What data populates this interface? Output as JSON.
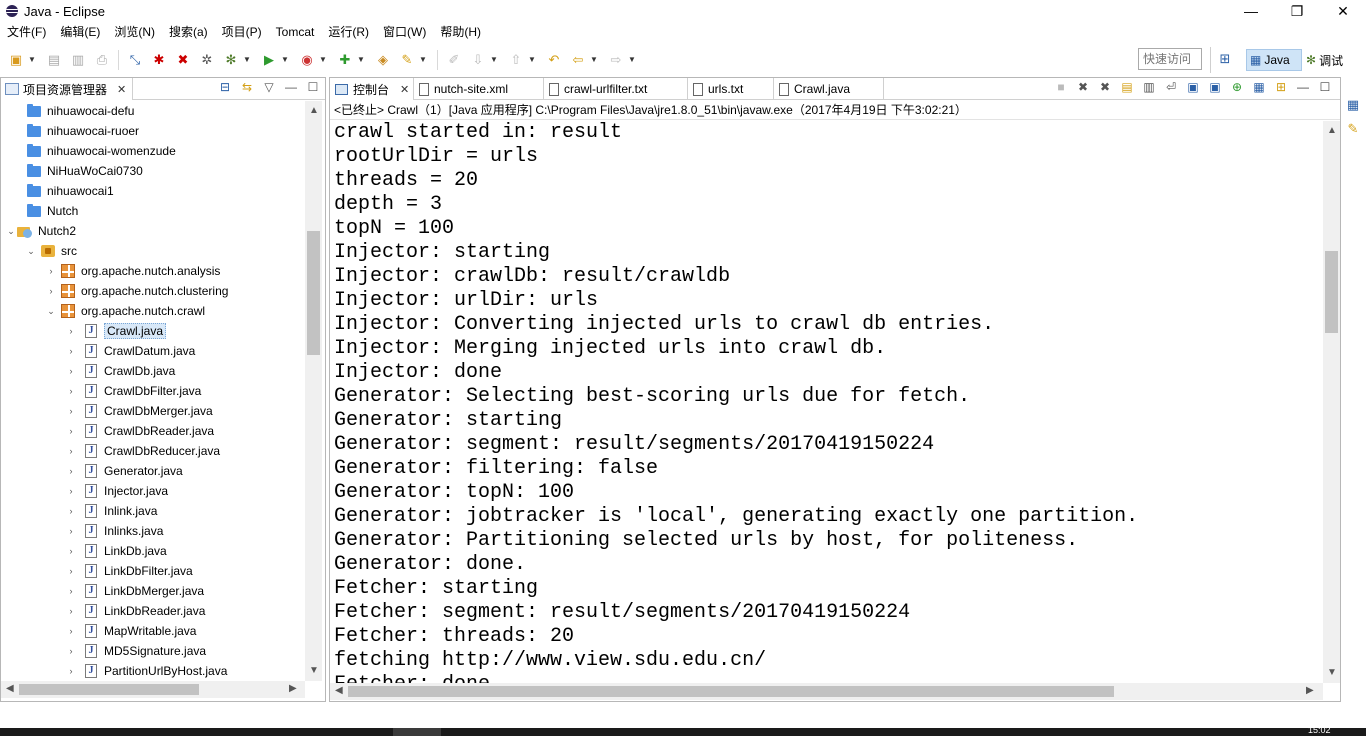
{
  "window": {
    "title": "Java - Eclipse",
    "controls": {
      "minimize": "—",
      "restore": "❐",
      "close": "✕"
    }
  },
  "menu": [
    "文件(F)",
    "编辑(E)",
    "浏览(N)",
    "搜索(a)",
    "项目(P)",
    "Tomcat",
    "运行(R)",
    "窗口(W)",
    "帮助(H)"
  ],
  "toolbar": {
    "quick_access_placeholder": "快速访问",
    "perspectives": {
      "java": "Java",
      "debug": "调试"
    }
  },
  "explorer": {
    "title": "项目资源管理器",
    "items": [
      {
        "label": "nihuawocai-defu",
        "type": "folder",
        "level": 0
      },
      {
        "label": "nihuawocai-ruoer",
        "type": "folder",
        "level": 0
      },
      {
        "label": "nihuawocai-womenzude",
        "type": "folder",
        "level": 0
      },
      {
        "label": "NiHuaWoCai0730",
        "type": "folder",
        "level": 0
      },
      {
        "label": "nihuawocai1",
        "type": "folder",
        "level": 0
      },
      {
        "label": "Nutch",
        "type": "folder",
        "level": 0
      },
      {
        "label": "Nutch2",
        "type": "project",
        "level": 0,
        "expanded": true
      },
      {
        "label": "src",
        "type": "src",
        "level": 1,
        "expanded": true
      },
      {
        "label": "org.apache.nutch.analysis",
        "type": "package",
        "level": 2
      },
      {
        "label": "org.apache.nutch.clustering",
        "type": "package",
        "level": 2
      },
      {
        "label": "org.apache.nutch.crawl",
        "type": "package",
        "level": 2,
        "expanded": true
      },
      {
        "label": "Crawl.java",
        "type": "java",
        "level": 3,
        "selected": true
      },
      {
        "label": "CrawlDatum.java",
        "type": "java",
        "level": 3
      },
      {
        "label": "CrawlDb.java",
        "type": "java",
        "level": 3
      },
      {
        "label": "CrawlDbFilter.java",
        "type": "java",
        "level": 3
      },
      {
        "label": "CrawlDbMerger.java",
        "type": "java",
        "level": 3
      },
      {
        "label": "CrawlDbReader.java",
        "type": "java",
        "level": 3
      },
      {
        "label": "CrawlDbReducer.java",
        "type": "java",
        "level": 3
      },
      {
        "label": "Generator.java",
        "type": "java",
        "level": 3
      },
      {
        "label": "Injector.java",
        "type": "java",
        "level": 3
      },
      {
        "label": "Inlink.java",
        "type": "java",
        "level": 3
      },
      {
        "label": "Inlinks.java",
        "type": "java",
        "level": 3
      },
      {
        "label": "LinkDb.java",
        "type": "java",
        "level": 3
      },
      {
        "label": "LinkDbFilter.java",
        "type": "java",
        "level": 3
      },
      {
        "label": "LinkDbMerger.java",
        "type": "java",
        "level": 3
      },
      {
        "label": "LinkDbReader.java",
        "type": "java",
        "level": 3
      },
      {
        "label": "MapWritable.java",
        "type": "java",
        "level": 3
      },
      {
        "label": "MD5Signature.java",
        "type": "java",
        "level": 3
      },
      {
        "label": "PartitionUrlByHost.java",
        "type": "java",
        "level": 3
      }
    ]
  },
  "editor_tabs": [
    {
      "label": "控制台",
      "icon": "console-icon",
      "active": true,
      "closable": true
    },
    {
      "label": "nutch-site.xml",
      "icon": "file-icon"
    },
    {
      "label": "crawl-urlfilter.txt",
      "icon": "file-icon"
    },
    {
      "label": "urls.txt",
      "icon": "file-icon"
    },
    {
      "label": "Crawl.java",
      "icon": "java-file-icon"
    }
  ],
  "console": {
    "status": "<已终止> Crawl（1）[Java 应用程序] C:\\Program Files\\Java\\jre1.8.0_51\\bin\\javaw.exe（2017年4月19日 下午3:02:21）",
    "lines": [
      "crawl started in: result",
      "rootUrlDir = urls",
      "threads = 20",
      "depth = 3",
      "topN = 100",
      "Injector: starting",
      "Injector: crawlDb: result/crawldb",
      "Injector: urlDir: urls",
      "Injector: Converting injected urls to crawl db entries.",
      "Injector: Merging injected urls into crawl db.",
      "Injector: done",
      "Generator: Selecting best-scoring urls due for fetch.",
      "Generator: starting",
      "Generator: segment: result/segments/20170419150224",
      "Generator: filtering: false",
      "Generator: topN: 100",
      "Generator: jobtracker is 'local', generating exactly one partition.",
      "Generator: Partitioning selected urls by host, for politeness.",
      "Generator: done.",
      "Fetcher: starting",
      "Fetcher: segment: result/segments/20170419150224",
      "Fetcher: threads: 20",
      "fetching http://www.view.sdu.edu.cn/",
      "Fetcher: done"
    ]
  },
  "taskbar": {
    "clock": "15:02"
  }
}
